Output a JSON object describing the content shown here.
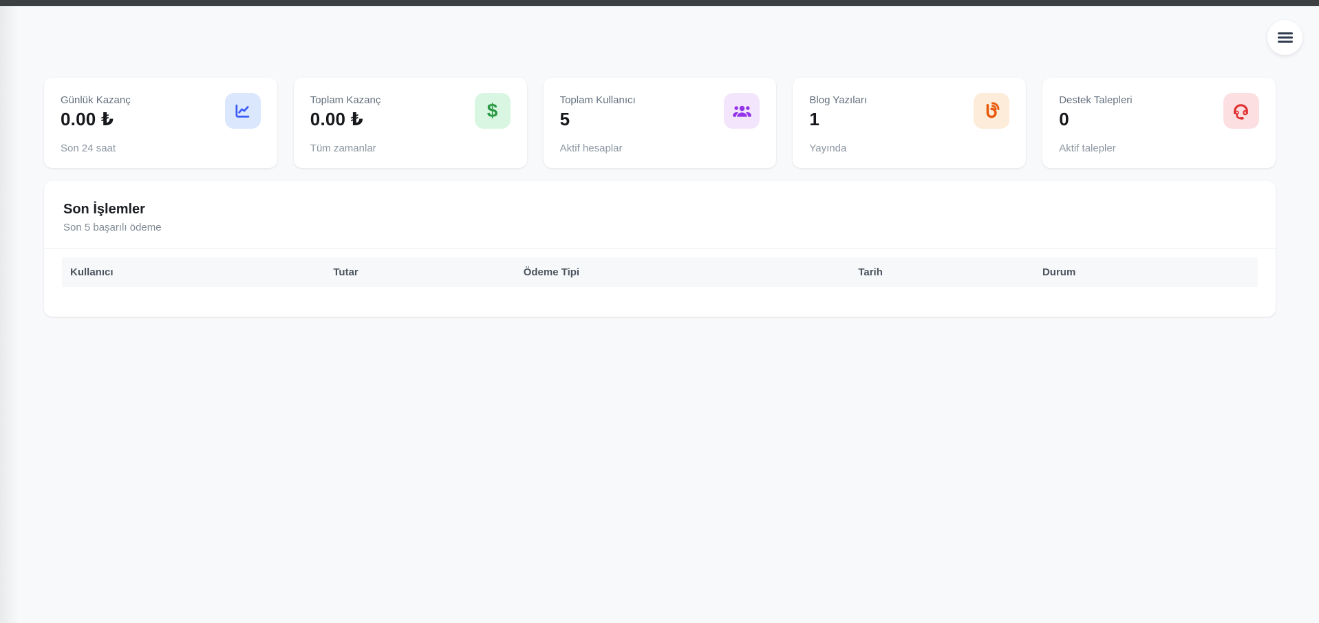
{
  "colors": {
    "background": "#f8f9fb",
    "topbar": "#3c4043",
    "card_background": "#ffffff",
    "divider": "#e9ecef",
    "table_header_background": "#f7f8fa",
    "stat_icon_blue": "#3b5bf6",
    "stat_icon_green": "#2b9a44",
    "stat_icon_purple": "#9333ea",
    "stat_icon_orange": "#e8590c",
    "stat_icon_red": "#e03131"
  },
  "header": {
    "menu_button_icon": "hamburger-icon"
  },
  "stats_cards": [
    {
      "title": "Günlük Kazanç",
      "value": "0.00 ₺",
      "subtitle": "Son 24 saat",
      "icon": "chart-line-icon",
      "icon_color": "#3b5bf6",
      "icon_bg": "#dbe7fd"
    },
    {
      "title": "Toplam Kazanç",
      "value": "0.00 ₺",
      "subtitle": "Tüm zamanlar",
      "icon": "dollar-icon",
      "icon_color": "#2b9a44",
      "icon_bg": "#d8f6e1"
    },
    {
      "title": "Toplam Kullanıcı",
      "value": "5",
      "subtitle": "Aktif hesaplar",
      "icon": "users-icon",
      "icon_color": "#9333ea",
      "icon_bg": "#f3e6fc"
    },
    {
      "title": "Blog Yazıları",
      "value": "1",
      "subtitle": "Yayında",
      "icon": "blog-icon",
      "icon_color": "#e8590c",
      "icon_bg": "#fcecd9"
    },
    {
      "title": "Destek Talepleri",
      "value": "0",
      "subtitle": "Aktif talepler",
      "icon": "headset-icon",
      "icon_color": "#e03131",
      "icon_bg": "#fcdfe1"
    }
  ],
  "transactions": {
    "title": "Son İşlemler",
    "subtitle": "Son 5 başarılı ödeme",
    "columns": [
      "Kullanıcı",
      "Tutar",
      "Ödeme Tipi",
      "Tarih",
      "Durum"
    ],
    "rows": []
  }
}
